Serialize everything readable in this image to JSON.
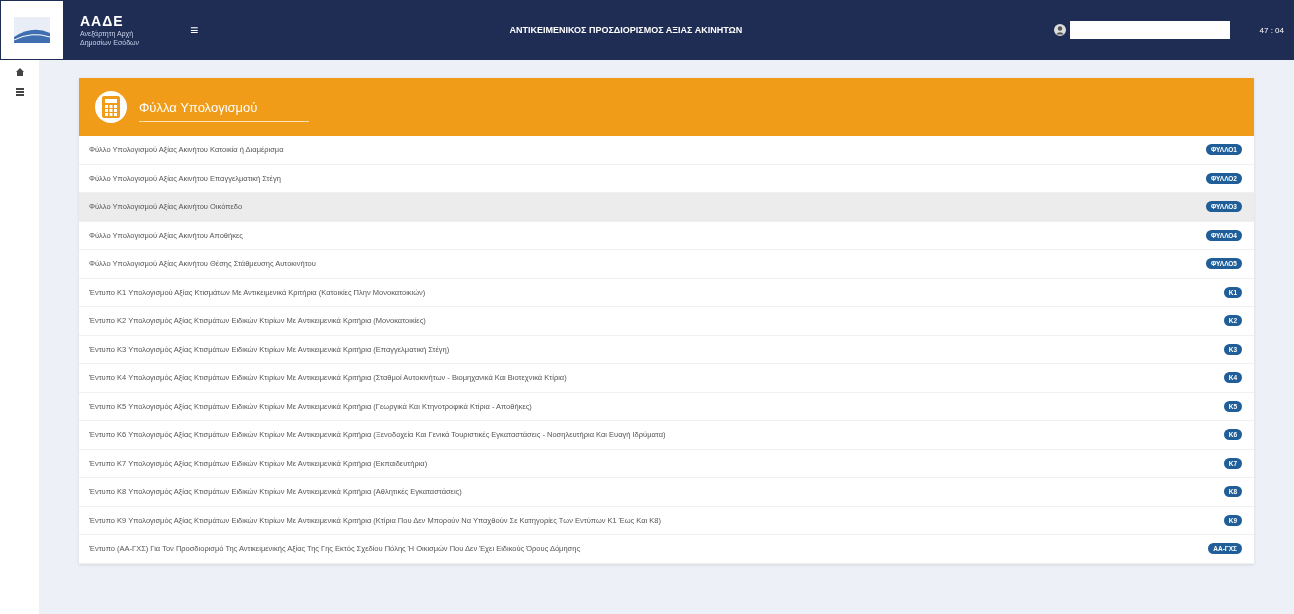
{
  "header": {
    "logo_title": "ΑΑΔΕ",
    "logo_subtitle": "Ανεξάρτητη Αρχή Δημοσίων Εσόδων",
    "menu_glyph": "≡",
    "title": "ΑΝΤΙΚΕΙΜΕΝΙΚΟΣ ΠΡΟΣΔΙΟΡΙΣΜΟΣ ΑΞΙΑΣ ΑΚΙΝΗΤΩΝ",
    "timer": "47 : 04"
  },
  "card": {
    "title": "Φύλλα Υπολογισμού",
    "rows": [
      {
        "label": "Φύλλο Υπολογισμού Αξίας Ακινήτου Κατοικία ή Διαμέρισμα",
        "badge": "ΦΥΛΛΟ1",
        "selected": false
      },
      {
        "label": "Φύλλο Υπολογισμού Αξίας Ακινήτου Επαγγελματική Στέγη",
        "badge": "ΦΥΛΛΟ2",
        "selected": false
      },
      {
        "label": "Φύλλο Υπολογισμού Αξίας Ακινήτου Οικόπεδο",
        "badge": "ΦΥΛΛΟ3",
        "selected": true
      },
      {
        "label": "Φύλλο Υπολογισμού Αξίας Ακινήτου Αποθήκες",
        "badge": "ΦΥΛΛΟ4",
        "selected": false
      },
      {
        "label": "Φύλλο Υπολογισμού Αξίας Ακινήτου Θέσης Στάθμευσης Αυτοκινήτου",
        "badge": "ΦΥΛΛΟ5",
        "selected": false
      },
      {
        "label": "Έντυπο Κ1 Υπολογισμού Αξίας Κτισμάτων Με Αντικειμενικά Κριτήρια (Κατοικίες Πλην Μονοκατοικιών)",
        "badge": "Κ1",
        "selected": false
      },
      {
        "label": "Έντυπο Κ2 Υπολογισμός Αξίας Κτισμάτων Ειδικών Κτιρίων Με Αντικειμενικά Κριτήρια (Μονοκατοικίες)",
        "badge": "Κ2",
        "selected": false
      },
      {
        "label": "Έντυπο Κ3 Υπολογισμός Αξίας Κτισμάτων Ειδικών Κτιρίων Με Αντικειμενικά Κριτήρια (Επαγγελματική Στέγη)",
        "badge": "Κ3",
        "selected": false
      },
      {
        "label": "Έντυπο Κ4 Υπολογισμός Αξίας Κτισμάτων Ειδικών Κτιρίων Με Αντικειμενικά Κριτήρια (Σταθμοί Αυτοκινήτων - Βιομηχανικά Και Βιοτεχνικά Κτίρια)",
        "badge": "Κ4",
        "selected": false
      },
      {
        "label": "Έντυπο Κ5 Υπολογισμός Αξίας Κτισμάτων Ειδικών Κτιρίων Με Αντικειμενικά Κριτήρια (Γεωργικά Και Κτηνοτροφικά Κτίρια - Αποθήκες)",
        "badge": "Κ5",
        "selected": false
      },
      {
        "label": "Έντυπο Κ6 Υπολογισμός Αξίας Κτισμάτων Ειδικών Κτιρίων Με Αντικειμενικά Κριτήρια (Ξενοδοχεία Και Γενικά Τουριστικές Εγκαταστάσεις - Νοσηλευτήρια Και Ευαγή Ιδρύματα)",
        "badge": "Κ6",
        "selected": false
      },
      {
        "label": "Έντυπο Κ7 Υπολογισμός Αξίας Κτισμάτων Ειδικών Κτιρίων Με Αντικειμενικά Κριτήρια (Εκπαιδευτήρια)",
        "badge": "Κ7",
        "selected": false
      },
      {
        "label": "Έντυπο Κ8 Υπολογισμός Αξίας Κτισμάτων Ειδικών Κτιρίων Με Αντικειμενικά Κριτήρια (Αθλητικές Εγκαταστάσεις)",
        "badge": "Κ8",
        "selected": false
      },
      {
        "label": "Έντυπο Κ9 Υπολογισμός Αξίας Κτισμάτων Ειδικών Κτιρίων Με Αντικειμενικά Κριτήρια (Κτίρια Που Δεν Μπορούν Να Υπαχθούν Σε Κατηγορίες Των Εντύπων Κ1 Έως Και Κ8)",
        "badge": "Κ9",
        "selected": false
      },
      {
        "label": "Έντυπο (ΑΑ-ΓΧΣ) Για Τον Προσδιορισμό Της Αντικειμενικής Αξίας Της Γης Εκτός Σχεδίου Πόλης Ή Οικισμών Που Δεν Έχει Ειδικούς Όρους Δόμησης",
        "badge": "ΑΑ-ΓΧΣ",
        "selected": false
      }
    ]
  }
}
